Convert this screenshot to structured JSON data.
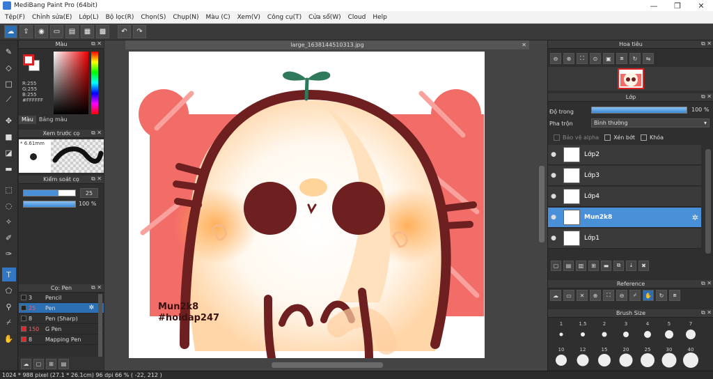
{
  "window": {
    "title": "MediBang Paint Pro (64bit)",
    "min": "—",
    "max": "❐",
    "close": "✕"
  },
  "menu": [
    "Tệp(F)",
    "Chỉnh sửa(E)",
    "Lớp(L)",
    "Bộ lọc(R)",
    "Chọn(S)",
    "Chụp(N)",
    "Màu (C)",
    "Xem(V)",
    "Công cụ(T)",
    "Cửa sổ(W)",
    "Cloud",
    "Help"
  ],
  "toolbar_icons": [
    "cloud-icon",
    "export-icon",
    "chat-icon",
    "comment-icon",
    "document-icon",
    "layout-icon",
    "grid-icon",
    "undo-icon",
    "redo-icon"
  ],
  "color_panel": {
    "title": "Màu",
    "r": "R:255",
    "g": "G:255",
    "b": "B:255",
    "hex": "#FFFFFF",
    "tab_color": "Màu",
    "tab_palette": "Bảng màu",
    "fg_color": "#e02020",
    "bg_color": "#ffffff"
  },
  "preview_panel": {
    "title": "Xem trước cọ",
    "size": "* 6.61mm"
  },
  "control_panel": {
    "title": "Kiểm soát cọ",
    "size_value": "25",
    "size_fill": 0.68,
    "opacity_value": "100 %",
    "opacity_fill": 1.0
  },
  "brush_panel": {
    "title": "Cọ: Pen",
    "items": [
      {
        "size": "3",
        "name": "Pencil",
        "color": "black",
        "active": false
      },
      {
        "size": "25",
        "name": "Pen",
        "color": "black",
        "active": true
      },
      {
        "size": "8",
        "name": "Pen (Sharp)",
        "color": "black",
        "active": false
      },
      {
        "size": "150",
        "name": "G Pen",
        "color": "red",
        "active": false
      },
      {
        "size": "8",
        "name": "Mapping Pen",
        "color": "red",
        "active": false
      }
    ]
  },
  "document": {
    "tab_title": "large_1638144510313.jpg",
    "close": "✕",
    "watermark_line1": "Mun2k8",
    "watermark_line2": "#hoidap247"
  },
  "navigator": {
    "title": "Hoa tiêu"
  },
  "layer_panel": {
    "title": "Lớp",
    "opacity_label": "Độ trong",
    "opacity_value": "100 %",
    "opacity_fill": 1.0,
    "blend_label": "Pha trộn",
    "blend_value": "Bình thường",
    "protect_alpha": "Bảo vệ alpha",
    "clipping": "Xén bớt",
    "lock": "Khóa",
    "layers": [
      {
        "name": "Lớp2",
        "active": false
      },
      {
        "name": "Lớp3",
        "active": false
      },
      {
        "name": "Lớp4",
        "active": false
      },
      {
        "name": "Mun2k8",
        "active": true
      },
      {
        "name": "Lớp1",
        "active": false
      }
    ]
  },
  "reference_panel": {
    "title": "Reference"
  },
  "brush_size_panel": {
    "title": "Brush Size",
    "sizes": [
      "1",
      "1.5",
      "2",
      "3",
      "4",
      "5",
      "7",
      "10",
      "12",
      "15",
      "20",
      "25",
      "30",
      "40"
    ]
  },
  "status": {
    "text": "1024 * 988 pixel  (27.1 * 26.1cm)  96 dpi  66 %  ( -22, 212 )"
  }
}
